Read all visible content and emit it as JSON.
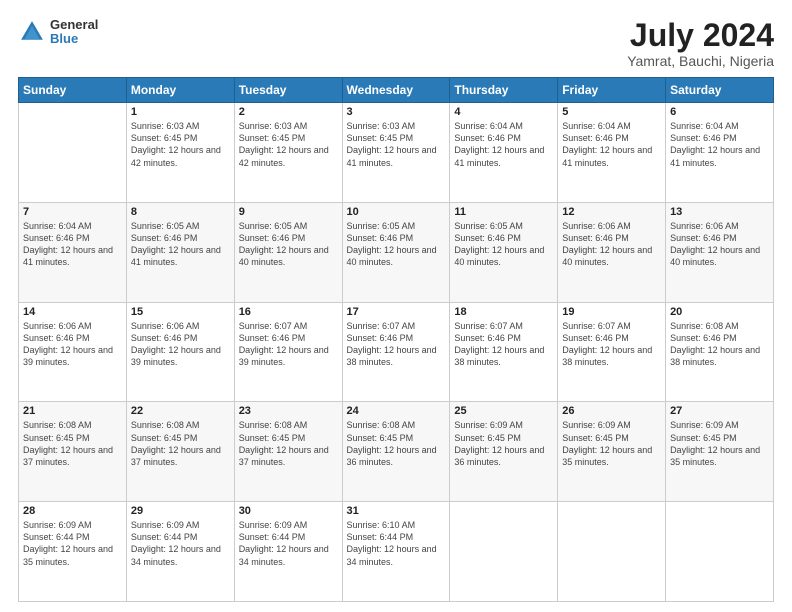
{
  "header": {
    "logo": {
      "line1": "General",
      "line2": "Blue"
    },
    "title": "July 2024",
    "subtitle": "Yamrat, Bauchi, Nigeria"
  },
  "days_of_week": [
    "Sunday",
    "Monday",
    "Tuesday",
    "Wednesday",
    "Thursday",
    "Friday",
    "Saturday"
  ],
  "weeks": [
    [
      {
        "day": "",
        "sunrise": "",
        "sunset": "",
        "daylight": ""
      },
      {
        "day": "1",
        "sunrise": "6:03 AM",
        "sunset": "6:45 PM",
        "daylight": "12 hours and 42 minutes."
      },
      {
        "day": "2",
        "sunrise": "6:03 AM",
        "sunset": "6:45 PM",
        "daylight": "12 hours and 42 minutes."
      },
      {
        "day": "3",
        "sunrise": "6:03 AM",
        "sunset": "6:45 PM",
        "daylight": "12 hours and 41 minutes."
      },
      {
        "day": "4",
        "sunrise": "6:04 AM",
        "sunset": "6:46 PM",
        "daylight": "12 hours and 41 minutes."
      },
      {
        "day": "5",
        "sunrise": "6:04 AM",
        "sunset": "6:46 PM",
        "daylight": "12 hours and 41 minutes."
      },
      {
        "day": "6",
        "sunrise": "6:04 AM",
        "sunset": "6:46 PM",
        "daylight": "12 hours and 41 minutes."
      }
    ],
    [
      {
        "day": "7",
        "sunrise": "6:04 AM",
        "sunset": "6:46 PM",
        "daylight": "12 hours and 41 minutes."
      },
      {
        "day": "8",
        "sunrise": "6:05 AM",
        "sunset": "6:46 PM",
        "daylight": "12 hours and 41 minutes."
      },
      {
        "day": "9",
        "sunrise": "6:05 AM",
        "sunset": "6:46 PM",
        "daylight": "12 hours and 40 minutes."
      },
      {
        "day": "10",
        "sunrise": "6:05 AM",
        "sunset": "6:46 PM",
        "daylight": "12 hours and 40 minutes."
      },
      {
        "day": "11",
        "sunrise": "6:05 AM",
        "sunset": "6:46 PM",
        "daylight": "12 hours and 40 minutes."
      },
      {
        "day": "12",
        "sunrise": "6:06 AM",
        "sunset": "6:46 PM",
        "daylight": "12 hours and 40 minutes."
      },
      {
        "day": "13",
        "sunrise": "6:06 AM",
        "sunset": "6:46 PM",
        "daylight": "12 hours and 40 minutes."
      }
    ],
    [
      {
        "day": "14",
        "sunrise": "6:06 AM",
        "sunset": "6:46 PM",
        "daylight": "12 hours and 39 minutes."
      },
      {
        "day": "15",
        "sunrise": "6:06 AM",
        "sunset": "6:46 PM",
        "daylight": "12 hours and 39 minutes."
      },
      {
        "day": "16",
        "sunrise": "6:07 AM",
        "sunset": "6:46 PM",
        "daylight": "12 hours and 39 minutes."
      },
      {
        "day": "17",
        "sunrise": "6:07 AM",
        "sunset": "6:46 PM",
        "daylight": "12 hours and 38 minutes."
      },
      {
        "day": "18",
        "sunrise": "6:07 AM",
        "sunset": "6:46 PM",
        "daylight": "12 hours and 38 minutes."
      },
      {
        "day": "19",
        "sunrise": "6:07 AM",
        "sunset": "6:46 PM",
        "daylight": "12 hours and 38 minutes."
      },
      {
        "day": "20",
        "sunrise": "6:08 AM",
        "sunset": "6:46 PM",
        "daylight": "12 hours and 38 minutes."
      }
    ],
    [
      {
        "day": "21",
        "sunrise": "6:08 AM",
        "sunset": "6:45 PM",
        "daylight": "12 hours and 37 minutes."
      },
      {
        "day": "22",
        "sunrise": "6:08 AM",
        "sunset": "6:45 PM",
        "daylight": "12 hours and 37 minutes."
      },
      {
        "day": "23",
        "sunrise": "6:08 AM",
        "sunset": "6:45 PM",
        "daylight": "12 hours and 37 minutes."
      },
      {
        "day": "24",
        "sunrise": "6:08 AM",
        "sunset": "6:45 PM",
        "daylight": "12 hours and 36 minutes."
      },
      {
        "day": "25",
        "sunrise": "6:09 AM",
        "sunset": "6:45 PM",
        "daylight": "12 hours and 36 minutes."
      },
      {
        "day": "26",
        "sunrise": "6:09 AM",
        "sunset": "6:45 PM",
        "daylight": "12 hours and 35 minutes."
      },
      {
        "day": "27",
        "sunrise": "6:09 AM",
        "sunset": "6:45 PM",
        "daylight": "12 hours and 35 minutes."
      }
    ],
    [
      {
        "day": "28",
        "sunrise": "6:09 AM",
        "sunset": "6:44 PM",
        "daylight": "12 hours and 35 minutes."
      },
      {
        "day": "29",
        "sunrise": "6:09 AM",
        "sunset": "6:44 PM",
        "daylight": "12 hours and 34 minutes."
      },
      {
        "day": "30",
        "sunrise": "6:09 AM",
        "sunset": "6:44 PM",
        "daylight": "12 hours and 34 minutes."
      },
      {
        "day": "31",
        "sunrise": "6:10 AM",
        "sunset": "6:44 PM",
        "daylight": "12 hours and 34 minutes."
      },
      {
        "day": "",
        "sunrise": "",
        "sunset": "",
        "daylight": ""
      },
      {
        "day": "",
        "sunrise": "",
        "sunset": "",
        "daylight": ""
      },
      {
        "day": "",
        "sunrise": "",
        "sunset": "",
        "daylight": ""
      }
    ]
  ]
}
